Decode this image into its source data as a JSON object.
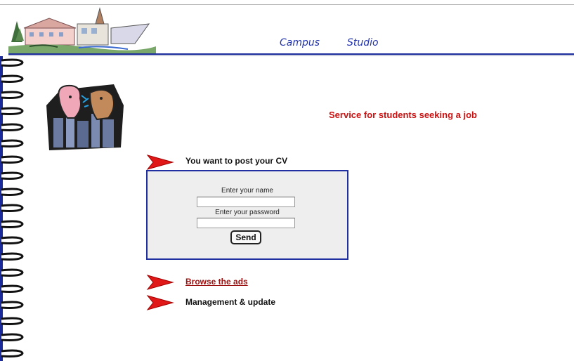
{
  "nav": {
    "campus": "Campus",
    "studio": "Studio"
  },
  "service_title": "Service for students seeking a job",
  "post_cv": {
    "label": "You want to post your CV",
    "name_label": "Enter your name",
    "name_value": "",
    "password_label": "Enter your password",
    "password_value": "",
    "send_label": "Send"
  },
  "links": {
    "browse": "Browse the ads",
    "management": "Management & update"
  },
  "colors": {
    "accent_blue": "#1b2a9a",
    "title_red": "#cc1111",
    "arrow_red": "#e01818",
    "link_red": "#991111"
  },
  "icons": {
    "arrow": "red-arrow-icon",
    "spiral": "notebook-spiral-binding",
    "clipart": "two-faces-city-clipart"
  }
}
